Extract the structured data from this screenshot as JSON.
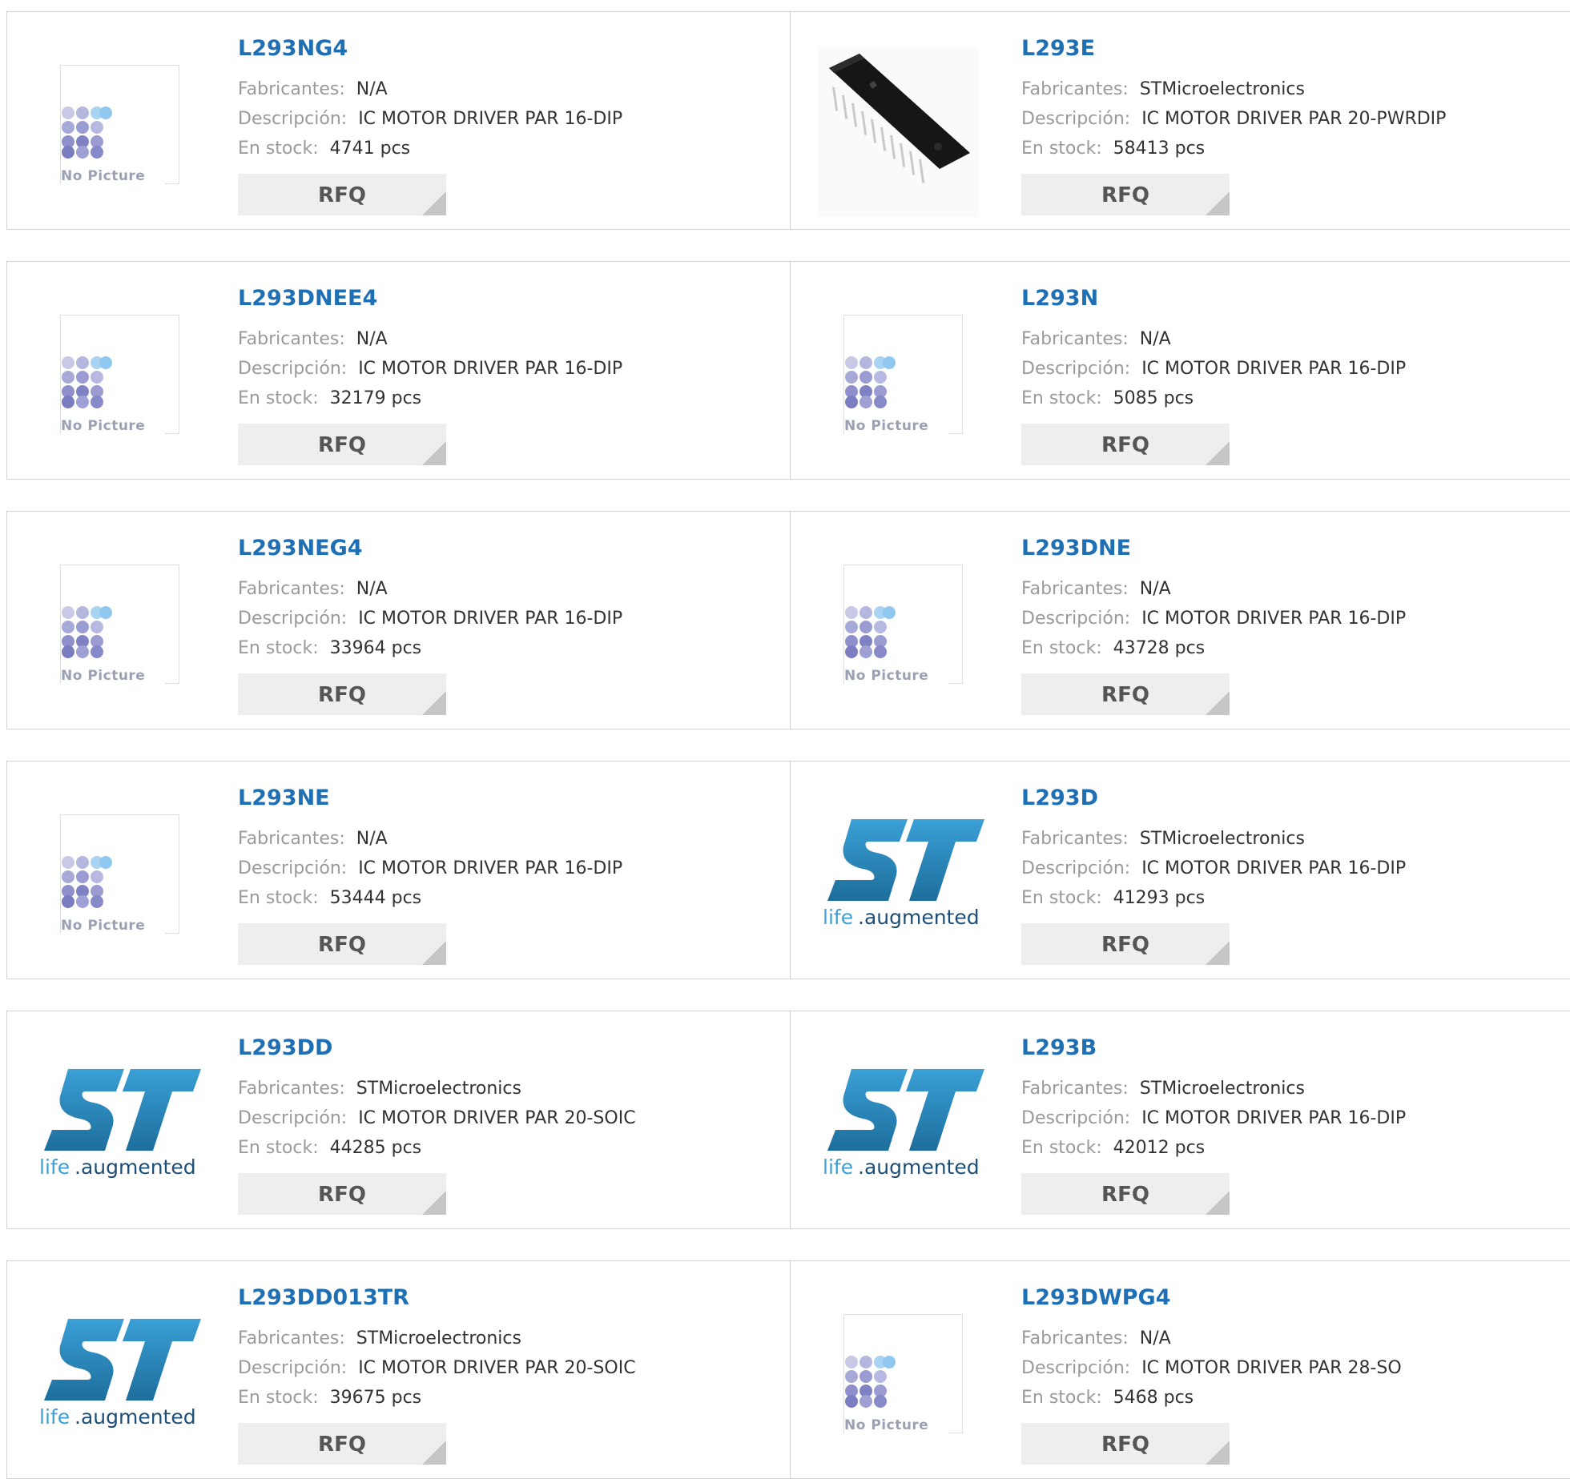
{
  "labels": {
    "manufacturer": "Fabricantes:",
    "description": "Descripción:",
    "stock": "En stock:",
    "rfq": "RFQ",
    "no_picture": "No Picture",
    "st_tagline_a": "life",
    "st_tagline_b": ".augmented"
  },
  "products": [
    {
      "part": "L293NG4",
      "manufacturer": "N/A",
      "description": "IC MOTOR DRIVER PAR 16-DIP",
      "stock": "4741 pcs",
      "image": "no-picture"
    },
    {
      "part": "L293E",
      "manufacturer": "STMicroelectronics",
      "description": "IC MOTOR DRIVER PAR 20-PWRDIP",
      "stock": "58413 pcs",
      "image": "dip-chip"
    },
    {
      "part": "L293DNEE4",
      "manufacturer": "N/A",
      "description": "IC MOTOR DRIVER PAR 16-DIP",
      "stock": "32179 pcs",
      "image": "no-picture"
    },
    {
      "part": "L293N",
      "manufacturer": "N/A",
      "description": "IC MOTOR DRIVER PAR 16-DIP",
      "stock": "5085 pcs",
      "image": "no-picture"
    },
    {
      "part": "L293NEG4",
      "manufacturer": "N/A",
      "description": "IC MOTOR DRIVER PAR 16-DIP",
      "stock": "33964 pcs",
      "image": "no-picture"
    },
    {
      "part": "L293DNE",
      "manufacturer": "N/A",
      "description": "IC MOTOR DRIVER PAR 16-DIP",
      "stock": "43728 pcs",
      "image": "no-picture"
    },
    {
      "part": "L293NE",
      "manufacturer": "N/A",
      "description": "IC MOTOR DRIVER PAR 16-DIP",
      "stock": "53444 pcs",
      "image": "no-picture"
    },
    {
      "part": "L293D",
      "manufacturer": "STMicroelectronics",
      "description": "IC MOTOR DRIVER PAR 16-DIP",
      "stock": "41293 pcs",
      "image": "st-logo"
    },
    {
      "part": "L293DD",
      "manufacturer": "STMicroelectronics",
      "description": "IC MOTOR DRIVER PAR 20-SOIC",
      "stock": "44285 pcs",
      "image": "st-logo"
    },
    {
      "part": "L293B",
      "manufacturer": "STMicroelectronics",
      "description": "IC MOTOR DRIVER PAR 16-DIP",
      "stock": "42012 pcs",
      "image": "st-logo"
    },
    {
      "part": "L293DD013TR",
      "manufacturer": "STMicroelectronics",
      "description": "IC MOTOR DRIVER PAR 20-SOIC",
      "stock": "39675 pcs",
      "image": "st-logo"
    },
    {
      "part": "L293DWPG4",
      "manufacturer": "N/A",
      "description": "IC MOTOR DRIVER PAR 28-SO",
      "stock": "5468 pcs",
      "image": "no-picture"
    }
  ],
  "colors": {
    "part_link": "#1f6fb5",
    "label_gray": "#9a9a9a",
    "value_text": "#333333",
    "border": "#d2d2d2",
    "rfq_bg": "#eeeeee",
    "st_blue": "#2a8cc4"
  }
}
